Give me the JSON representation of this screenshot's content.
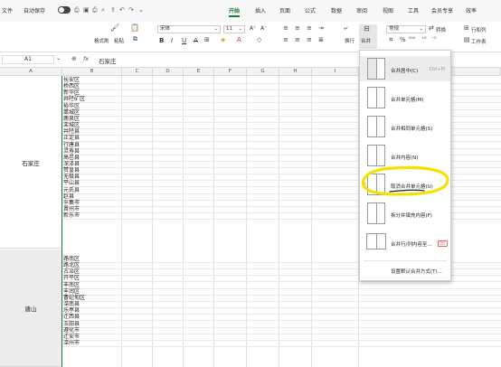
{
  "menubar": {
    "file": "文件",
    "autosave": "自动保存",
    "tabs": [
      "开始",
      "插入",
      "页面",
      "公式",
      "数据",
      "审阅",
      "视图",
      "工具",
      "会员专享",
      "效率"
    ],
    "active_tab": "开始"
  },
  "ribbon": {
    "format_painter": "格式刷",
    "paste": "粘贴",
    "font_name": "宋体",
    "font_size": "11",
    "wrap": "换行",
    "merge": "合并",
    "number_format": "常规",
    "convert": "转换",
    "row_col": "行和列",
    "worksheet": "工作表",
    "bold": "B",
    "italic": "I",
    "underline": "U",
    "strike": "A"
  },
  "formula_bar": {
    "cell_ref": "A1",
    "fx": "fx",
    "content": "石家庄"
  },
  "grid": {
    "columns": [
      "A",
      "B",
      "C",
      "D",
      "E",
      "F",
      "G",
      "H",
      "I"
    ],
    "selected_column": "A",
    "group1_label": "石家庄",
    "group1": [
      "长安区",
      "桥西区",
      "新华区",
      "井陉矿区",
      "裕华区",
      "藁城区",
      "鹿泉区",
      "栾城区",
      "井陉县",
      "正定县",
      "行唐县",
      "灵寿县",
      "高邑县",
      "深泽县",
      "赞皇县",
      "无极县",
      "平山县",
      "元氏县",
      "赵县",
      "辛集市",
      "晋州市",
      "新乐市"
    ],
    "group2_label": "唐山",
    "group2": [
      "路南区",
      "路北区",
      "古冶区",
      "开平区",
      "丰南区",
      "丰润区",
      "曹妃甸区",
      "滦南县",
      "乐亭县",
      "迁西县",
      "玉田县",
      "遵化市",
      "迁安市",
      "滦州市"
    ]
  },
  "merge_menu": {
    "items": [
      {
        "label": "合并居中(C)",
        "shortcut": "Ctrl+M"
      },
      {
        "label": "合并单元格(M)",
        "shortcut": ""
      },
      {
        "label": "合并相同单元格(S)",
        "shortcut": ""
      },
      {
        "label": "合并内容(N)",
        "shortcut": ""
      },
      {
        "label": "取消合并单元格(U)",
        "shortcut": ""
      },
      {
        "label": "拆分并填充内容(F)",
        "shortcut": ""
      },
      {
        "label": "合并行/列内容至...",
        "shortcut": ""
      }
    ],
    "badge": "DIY",
    "footer": "设置默认合并方式(T)..."
  },
  "colors": {
    "accent": "#1a7f37",
    "highlight_circle": "#f5e100",
    "badge": "#e46c5a"
  }
}
